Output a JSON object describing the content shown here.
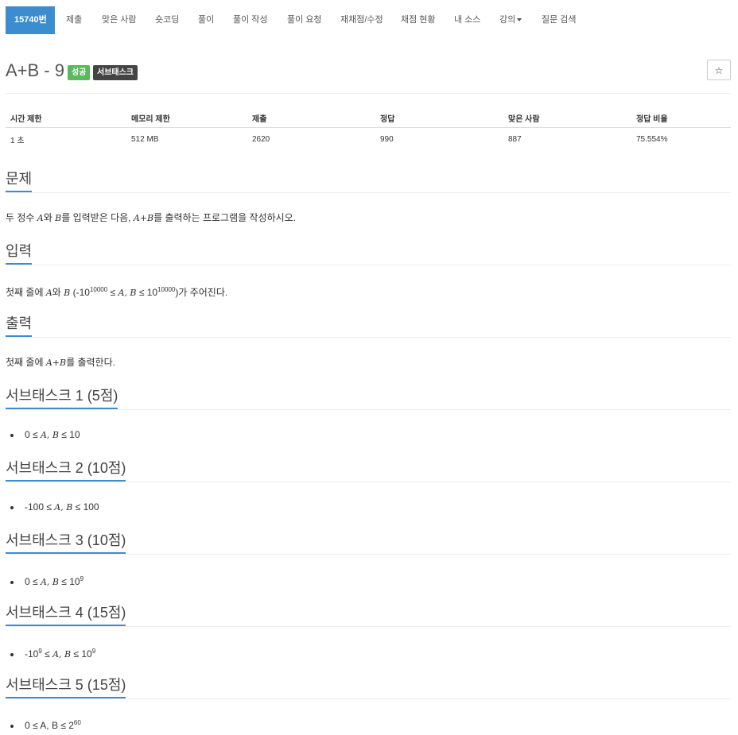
{
  "nav": {
    "items": [
      "15740번",
      "제출",
      "맞은 사람",
      "숏코딩",
      "풀이",
      "풀이 작성",
      "풀이 요청",
      "재채점/수정",
      "채점 현황",
      "내 소스",
      "강의",
      "질문 검색"
    ]
  },
  "problem": {
    "title": "A+B - 9",
    "label_success": "성공",
    "label_subtask": "서브태스크",
    "star": "☆"
  },
  "info": {
    "headers": [
      "시간 제한",
      "메모리 제한",
      "제출",
      "정답",
      "맞은 사람",
      "정답 비율"
    ],
    "values": [
      "1 초",
      "512 MB",
      "2620",
      "990",
      "887",
      "75.554%"
    ]
  },
  "sections": {
    "problem": {
      "title": "문제",
      "p1": "두 정수 ",
      "a": "A",
      "p2": "와 ",
      "b": "B",
      "p3": "를 입력받은 다음, ",
      "apb": "A+B",
      "p4": "를 출력하는 프로그램을 작성하시오."
    },
    "input": {
      "title": "입력",
      "p1": "첫째 줄에 ",
      "a": "A",
      "p2": "와 ",
      "b": "B",
      "p3": " (-10",
      "exp1": "10000",
      "p4": " ≤ ",
      "ab": "A, B",
      "p5": " ≤ 10",
      "exp2": "10000",
      "p6": ")가 주어진다."
    },
    "output": {
      "title": "출력",
      "p1": "첫째 줄에 ",
      "apb": "A+B",
      "p2": "를 출력한다."
    }
  },
  "subtasks": [
    {
      "title": "서브태스크 1 (5점)",
      "pre": "0 ≤ ",
      "ab": "A, B",
      "post": " ≤ 10",
      "sup": ""
    },
    {
      "title": "서브태스크 2 (10점)",
      "pre": "-100 ≤ ",
      "ab": "A, B",
      "post": " ≤ 100",
      "sup": ""
    },
    {
      "title": "서브태스크 3 (10점)",
      "pre": "0 ≤ ",
      "ab": "A, B",
      "post": " ≤ 10",
      "sup": "9"
    },
    {
      "title": "서브태스크 4 (15점)",
      "pre": "-10",
      "presup": "9",
      "pre2": " ≤ ",
      "ab": "A, B",
      "post": " ≤ 10",
      "sup": "9"
    },
    {
      "title": "서브태스크 5 (15점)",
      "pre": "0 ≤ A, B ≤ 2",
      "sup": "60"
    }
  ]
}
